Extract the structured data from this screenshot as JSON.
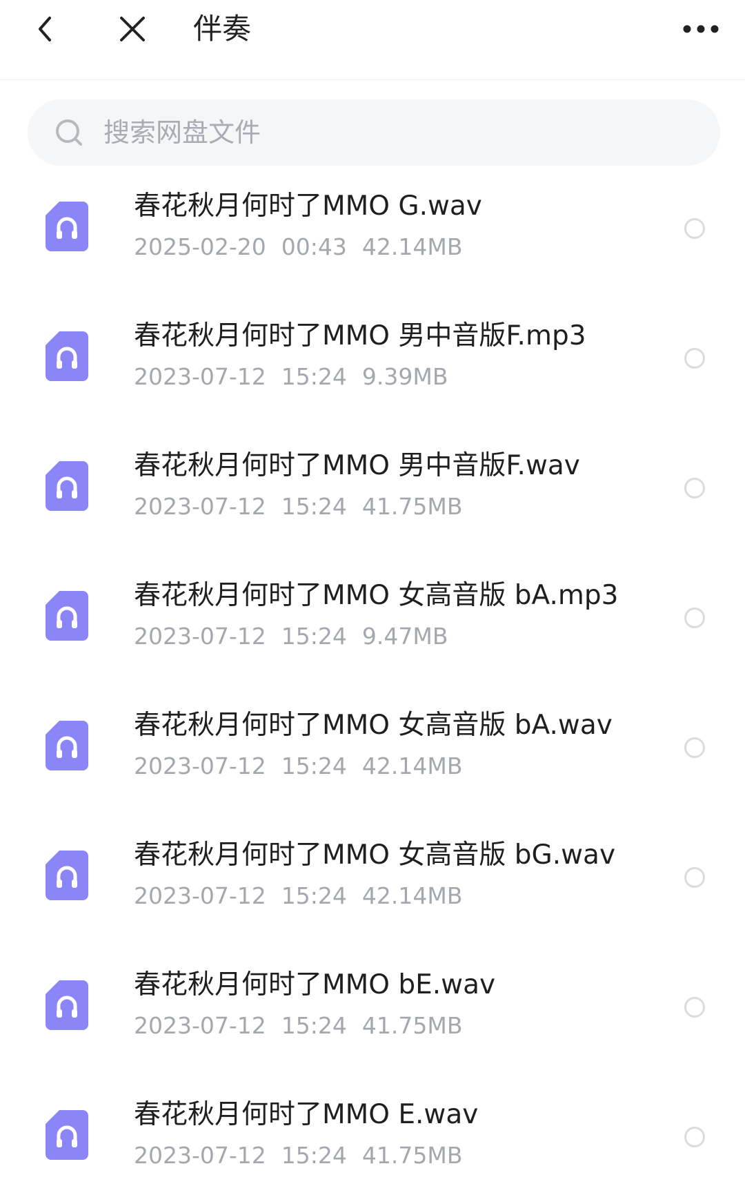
{
  "header": {
    "title": "伴奏",
    "back_icon": "chevron-left-icon",
    "close_icon": "close-icon",
    "more_icon": "more-dots-icon"
  },
  "search": {
    "placeholder": "搜索网盘文件",
    "icon": "search-icon"
  },
  "colors": {
    "file_icon": "#8a86f7",
    "meta_text": "#a4a7ae",
    "search_bg": "#f5f6f8"
  },
  "files": [
    {
      "name": "春花秋月何时了MMO  G.wav",
      "date": "2025-02-20",
      "time": "00:43",
      "size": "42.14MB"
    },
    {
      "name": "春花秋月何时了MMO 男中音版F.mp3",
      "date": "2023-07-12",
      "time": "15:24",
      "size": "9.39MB"
    },
    {
      "name": "春花秋月何时了MMO 男中音版F.wav",
      "date": "2023-07-12",
      "time": "15:24",
      "size": "41.75MB"
    },
    {
      "name": "春花秋月何时了MMO 女高音版 bA.mp3",
      "date": "2023-07-12",
      "time": "15:24",
      "size": "9.47MB"
    },
    {
      "name": "春花秋月何时了MMO 女高音版 bA.wav",
      "date": "2023-07-12",
      "time": "15:24",
      "size": "42.14MB"
    },
    {
      "name": "春花秋月何时了MMO 女高音版 bG.wav",
      "date": "2023-07-12",
      "time": "15:24",
      "size": "42.14MB"
    },
    {
      "name": "春花秋月何时了MMO bE.wav",
      "date": "2023-07-12",
      "time": "15:24",
      "size": "41.75MB"
    },
    {
      "name": "春花秋月何时了MMO E.wav",
      "date": "2023-07-12",
      "time": "15:24",
      "size": "41.75MB"
    }
  ]
}
